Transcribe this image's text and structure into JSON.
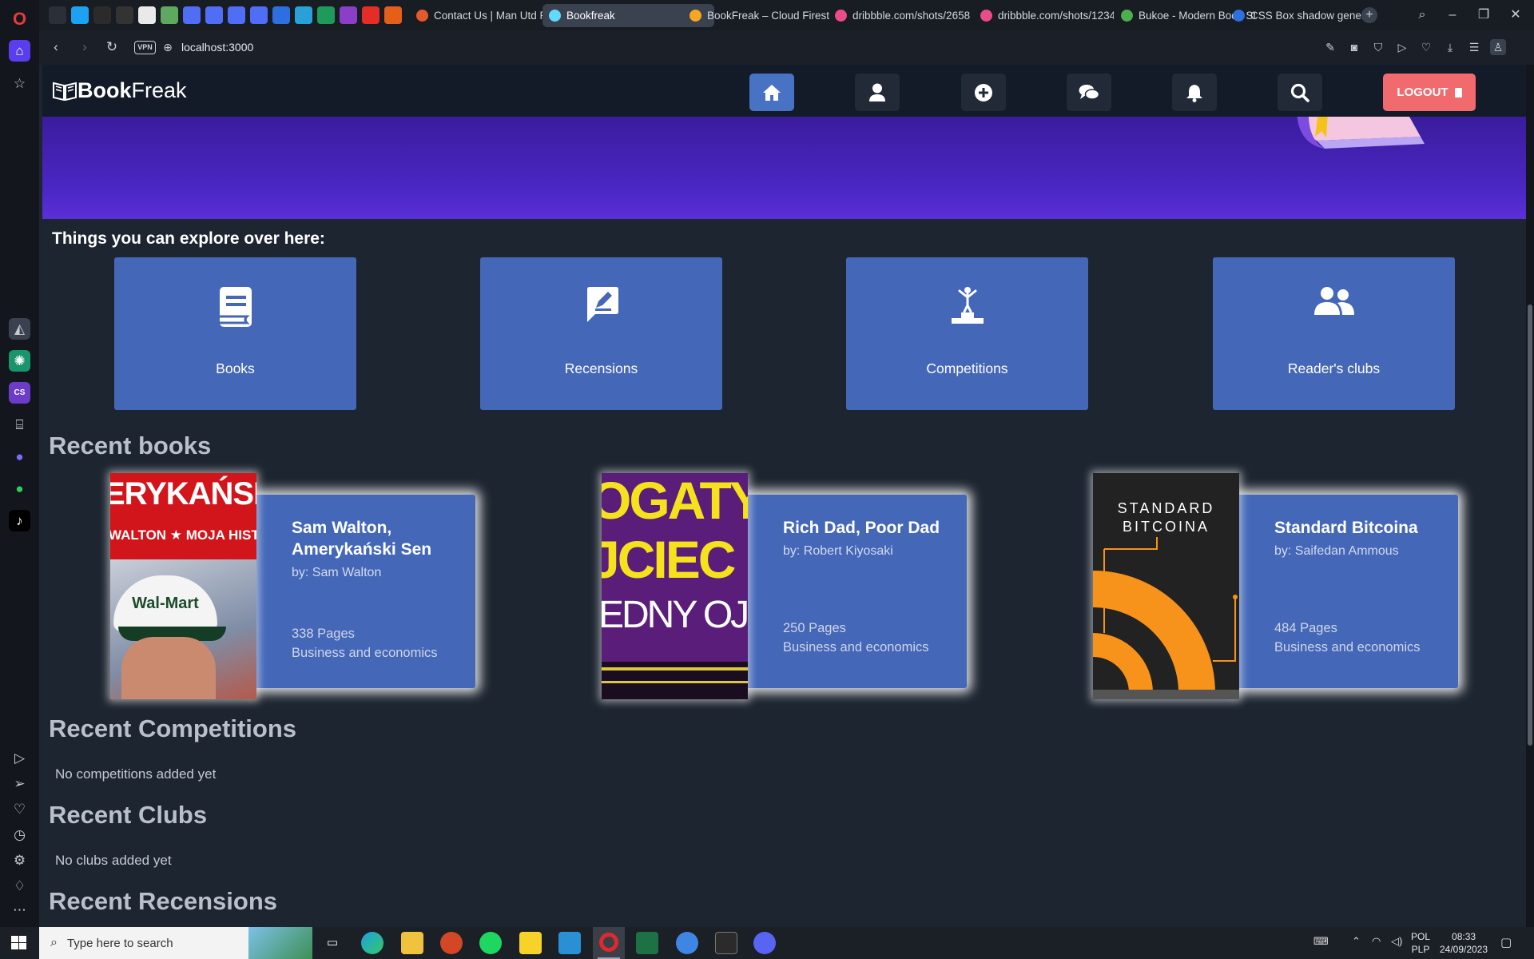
{
  "browser": {
    "tabs": [
      {
        "label": "Contact Us | Man Utd Pho",
        "color": "#e35b2c"
      },
      {
        "label": "Bookfreak",
        "color": "#61dafb"
      },
      {
        "label": "BookFreak – Cloud Firest",
        "color": "#f5a623"
      },
      {
        "label": "dribbble.com/shots/2658",
        "color": "#ea4c89"
      },
      {
        "label": "dribbble.com/shots/1234",
        "color": "#ea4c89"
      },
      {
        "label": "Bukoe - Modern Book St",
        "color": "#4caf50"
      },
      {
        "label": "CSS Box shadow generat",
        "color": "#2f6fe0"
      }
    ],
    "vpn_label": "VPN",
    "url": "localhost:3000"
  },
  "app": {
    "logo": {
      "part1": "Book",
      "part2": "Freak"
    },
    "logout_label": "LOGOUT"
  },
  "explore": {
    "title": "Things you can explore over here:",
    "cards": [
      {
        "label": "Books",
        "icon": "book-icon"
      },
      {
        "label": "Recensions",
        "icon": "review-icon"
      },
      {
        "label": "Competitions",
        "icon": "podium-icon"
      },
      {
        "label": "Reader's clubs",
        "icon": "users-icon"
      }
    ]
  },
  "recent_books": {
    "title": "Recent books",
    "items": [
      {
        "title": "Sam Walton, Amerykański Sen",
        "author": "by: Sam Walton",
        "pages": "338 Pages",
        "category": "Business and economics",
        "cover_text": "ERYKAŃSKI S",
        "cover_sub": "WALTON ★ MOJA HISTO",
        "cap_text": "Wal-Mart"
      },
      {
        "title": "Rich Dad, Poor Dad",
        "author": "by: Robert Kiyosaki",
        "pages": "250 Pages",
        "category": "Business and economics",
        "cover_text": "OGATY",
        "cover_sub": "JCIEC",
        "cover_sub2": "EDNY OJCIEC"
      },
      {
        "title": "Standard Bitcoina",
        "author": "by: Saifedan Ammous",
        "pages": "484 Pages",
        "category": "Business and economics",
        "cover_text": "STANDARD",
        "cover_sub": "BITCOINA"
      }
    ]
  },
  "recent_competitions": {
    "title": "Recent Competitions",
    "empty": "No competitions added yet"
  },
  "recent_clubs": {
    "title": "Recent Clubs",
    "empty": "No clubs added yet"
  },
  "recent_recensions": {
    "title": "Recent Recensions"
  },
  "taskbar": {
    "search_placeholder": "Type here to search",
    "lang1": "POL",
    "lang2": "PLP",
    "time": "08:33",
    "date": "24/09/2023"
  }
}
